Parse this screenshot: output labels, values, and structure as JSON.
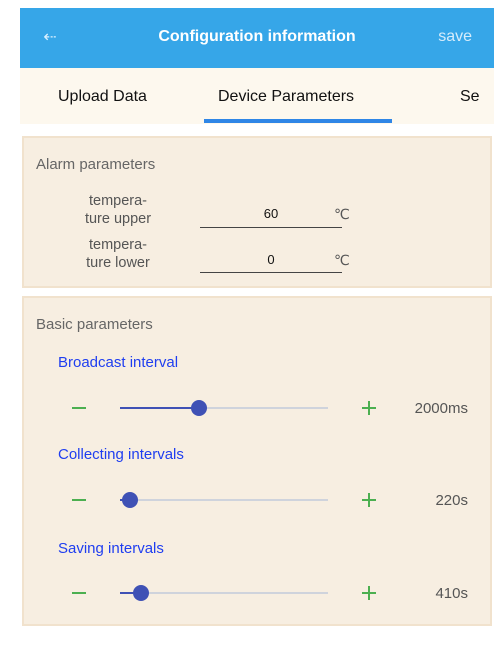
{
  "header": {
    "back_icon": "arrow-left-icon",
    "title": "Configuration information",
    "save_label": "save",
    "bg_color": "#36a6e8"
  },
  "tabs": [
    {
      "label": "Upload Data",
      "selected": false
    },
    {
      "label": "Device Parameters",
      "selected": true
    },
    {
      "label": "Se",
      "selected": false
    }
  ],
  "alarm": {
    "title": "Alarm parameters",
    "params": [
      {
        "label_line1": "tempera-",
        "label_line2": "ture upper",
        "value": "60",
        "unit": "℃"
      },
      {
        "label_line1": "tempera-",
        "label_line2": "ture lower",
        "value": "0",
        "unit": "℃"
      }
    ]
  },
  "basic": {
    "title": "Basic parameters",
    "sliders": [
      {
        "label": "Broadcast interval",
        "value_text": "2000ms",
        "fraction": 0.38
      },
      {
        "label": "Collecting intervals",
        "value_text": "220s",
        "fraction": 0.05
      },
      {
        "label": "Saving intervals",
        "value_text": "410s",
        "fraction": 0.1
      }
    ]
  },
  "colors": {
    "accent": "#2f86e6",
    "slider": "#3f51b5",
    "stepper": "#4caf50",
    "slider_label": "#1f3ef0"
  }
}
